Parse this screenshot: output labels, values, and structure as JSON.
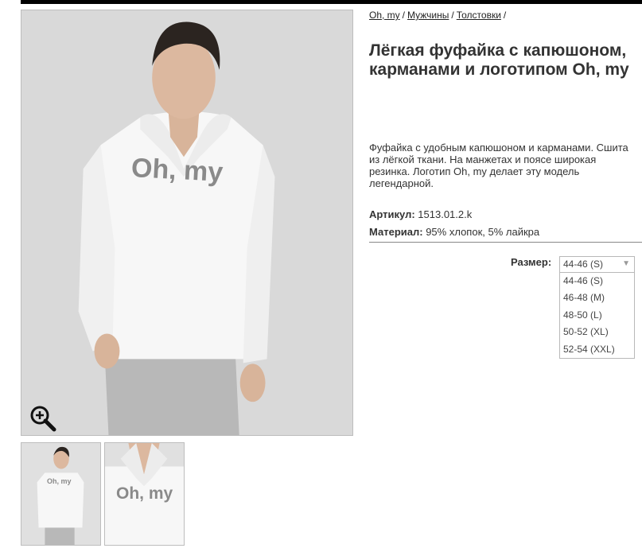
{
  "breadcrumb": {
    "items": [
      "Oh, my",
      "Мужчины",
      "Толстовки"
    ],
    "separator": "/"
  },
  "product": {
    "title": "Лёгкая фуфайка с капюшоном, карманами и логотипом Oh, my",
    "description": "Фуфайка с удобным капюшоном и карманами. Сшита из лёгкой ткани. На манжетах и поясе широкая резинка. Логотип Oh, my делает эту модель легендарной.",
    "article_label": "Артикул:",
    "article_value": "1513.01.2.k",
    "material_label": "Материал:",
    "material_value": "95% хлопок, 5% лайкра",
    "print_text": "Oh, my"
  },
  "size": {
    "label": "Размер:",
    "selected": "44-46 (S)",
    "options": [
      "44-46 (S)",
      "46-48 (M)",
      "48-50 (L)",
      "50-52 (XL)",
      "52-54 (XXL)"
    ]
  },
  "icons": {
    "zoom": "zoom-in-icon",
    "dropdown_arrow": "▼"
  },
  "colors": {
    "background": "#ffffff",
    "hoodie": "#f7f7f7",
    "print": "#8a8a8a",
    "pants": "#b8b8b8",
    "photo_bg": "#d9d9d9"
  }
}
